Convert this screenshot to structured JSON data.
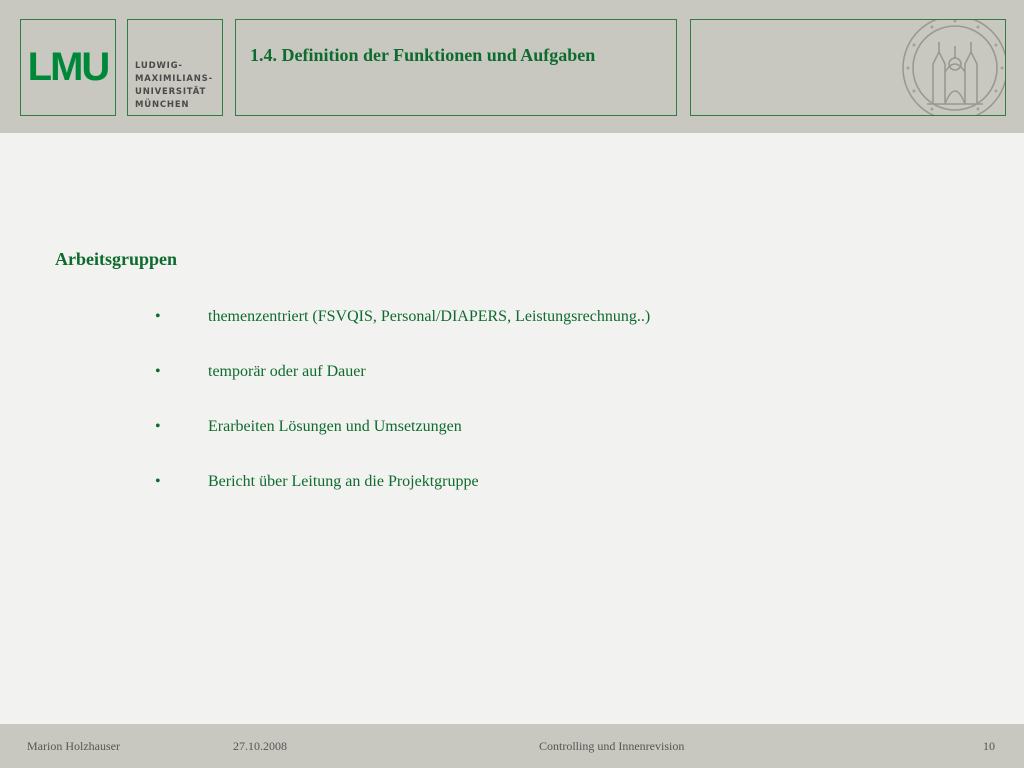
{
  "header": {
    "logo_text": "LMU",
    "university_name_lines": [
      "LUDWIG-",
      "MAXIMILIANS-",
      "UNIVERSITÄT",
      "MÜNCHEN"
    ],
    "slide_title": "1.4. Definition der Funktionen und Aufgaben",
    "seal_icon": "university-seal-icon"
  },
  "content": {
    "heading": "Arbeitsgruppen",
    "bullets": [
      "themenzentriert (FSVQIS, Personal/DIAPERS, Leistungsrechnung..)",
      "temporär oder auf Dauer",
      "Erarbeiten Lösungen und Umsetzungen",
      "Bericht über Leitung an die Projektgruppe"
    ],
    "bullet_glyph": "•"
  },
  "footer": {
    "author": "Marion Holzhauser",
    "date": "27.10.2008",
    "topic": "Controlling und Innenrevision",
    "page_number": "10"
  },
  "colors": {
    "brand_green": "#00883a",
    "text_green": "#0e6b2e",
    "band_gray": "#c8c8c0",
    "background": "#f2f2f0"
  }
}
